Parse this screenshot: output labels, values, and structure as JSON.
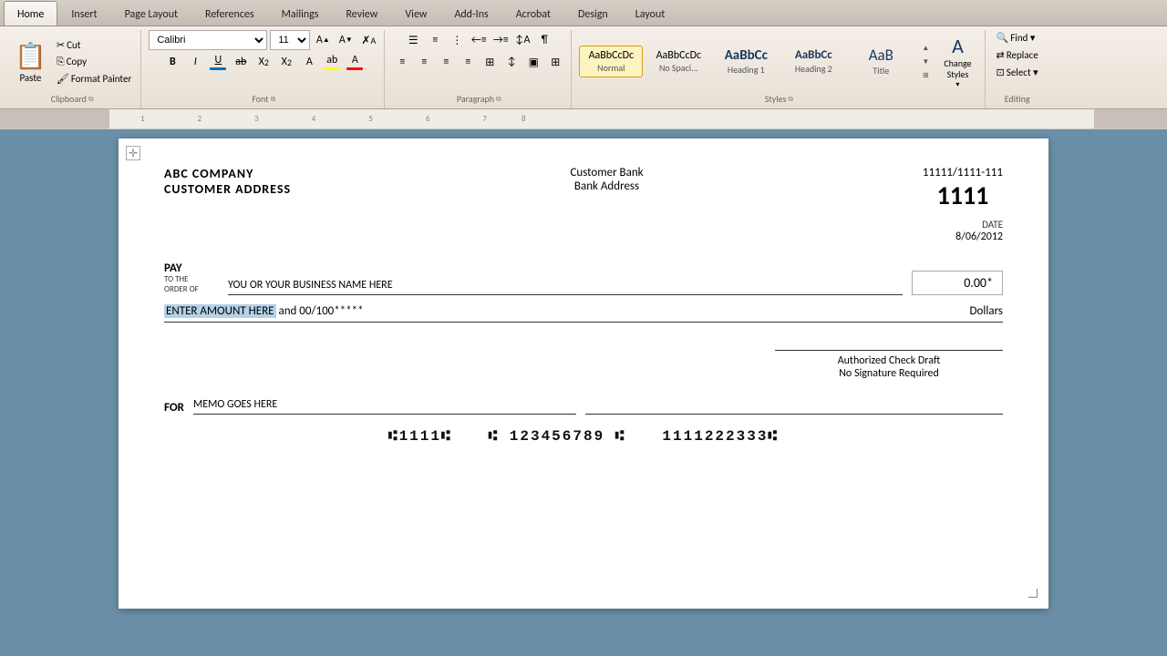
{
  "tabs": [
    {
      "label": "Home",
      "active": true
    },
    {
      "label": "Insert",
      "active": false
    },
    {
      "label": "Page Layout",
      "active": false
    },
    {
      "label": "References",
      "active": false
    },
    {
      "label": "Mailings",
      "active": false
    },
    {
      "label": "Review",
      "active": false
    },
    {
      "label": "View",
      "active": false
    },
    {
      "label": "Add-Ins",
      "active": false
    },
    {
      "label": "Acrobat",
      "active": false
    },
    {
      "label": "Design",
      "active": false
    },
    {
      "label": "Layout",
      "active": false
    }
  ],
  "font": {
    "name": "Calibri",
    "size": "11"
  },
  "styles": [
    {
      "label": "Normal",
      "preview": "AaBbCcDc",
      "active": true
    },
    {
      "label": "No Spaci...",
      "preview": "AaBbCcDc",
      "active": false
    },
    {
      "label": "Heading 1",
      "preview": "AaBbCc",
      "active": false
    },
    {
      "label": "Heading 2",
      "preview": "AaBbCc",
      "active": false
    },
    {
      "label": "Title",
      "preview": "AaB",
      "active": false
    }
  ],
  "change_styles_label": "Change\nStyles",
  "editing": {
    "find_label": "Find ▾",
    "replace_label": "Replace",
    "select_label": "Select ▾"
  },
  "check": {
    "company_name": "ABC COMPANY",
    "company_address": "CUSTOMER ADDRESS",
    "bank_name": "Customer Bank",
    "bank_address": "Bank Address",
    "routing": "11111/1111-111",
    "check_number": "1111",
    "date_label": "DATE",
    "date_value": "8/06/2012",
    "pay_label": "PAY",
    "pay_sublabel1": "TO THE",
    "pay_sublabel2": "ORDER OF",
    "payee": "YOU OR YOUR BUSINESS NAME HERE",
    "amount": "0.00*",
    "amount_written": "ENTER AMOUNT HERE",
    "amount_written_rest": " and 00/100*****",
    "dollars": "Dollars",
    "authorized_line1": "Authorized Check Draft",
    "authorized_line2": "No Signature Required",
    "for_label": "FOR",
    "memo": "MEMO GOES HERE",
    "micr_routing": "⑆1111⑆",
    "micr_account": "⑆ 123456789 ⑆",
    "micr_check": "1111222333⑆"
  },
  "plus_handle": "✛"
}
